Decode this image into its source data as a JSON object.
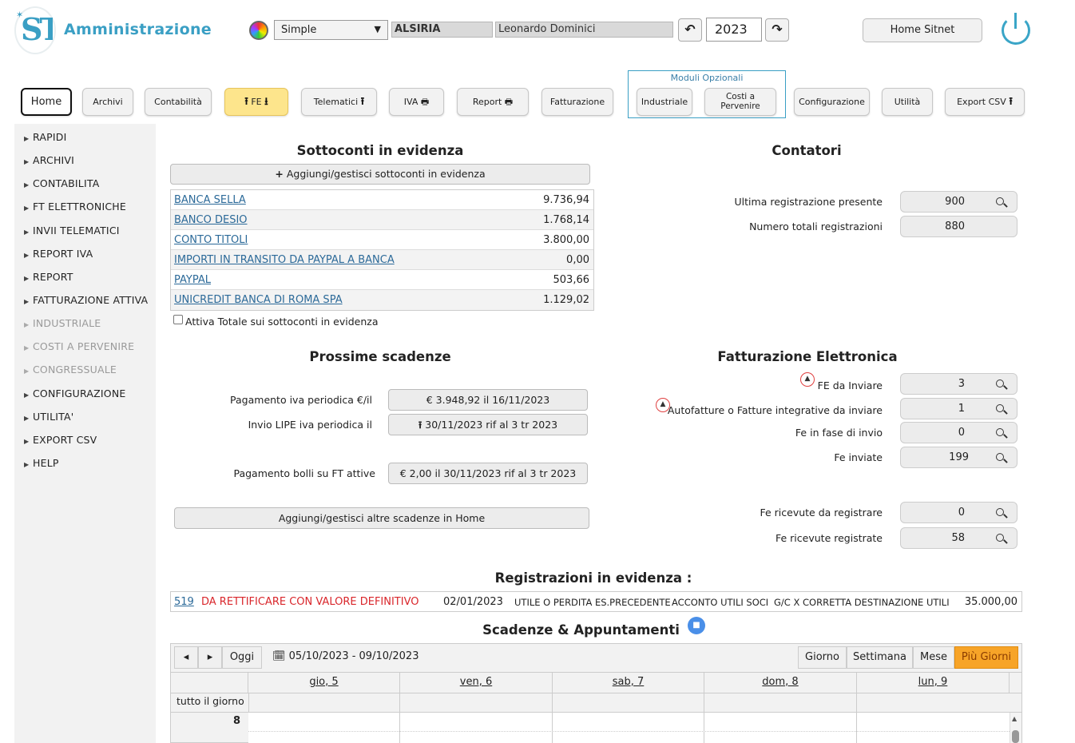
{
  "header": {
    "app_title": "Amministrazione",
    "view_select": "Simple",
    "company": "ALSIRIA",
    "user": "Leonardo Dominici",
    "year": "2023",
    "home_sitnet": "Home Sitnet"
  },
  "toolbar": {
    "home": "Home",
    "archivi": "Archivi",
    "contabilita": "Contabilità",
    "fe": "FE",
    "telematici": "Telematici",
    "iva": "IVA",
    "report": "Report",
    "fatturazione": "Fatturazione",
    "moduli_opzionali": "Moduli Opzionali",
    "industriale": "Industriale",
    "costi_1": "Costi a",
    "costi_2": "Pervenire",
    "configurazione": "Configurazione",
    "utilita": "Utilità",
    "export_csv": "Export CSV"
  },
  "sidebar": {
    "items": [
      {
        "label": "RAPIDI"
      },
      {
        "label": "ARCHIVI"
      },
      {
        "label": "CONTABILITA"
      },
      {
        "label": "FT ELETTRONICHE"
      },
      {
        "label": "INVII TELEMATICI"
      },
      {
        "label": "REPORT IVA"
      },
      {
        "label": "REPORT"
      },
      {
        "label": "FATTURAZIONE ATTIVA"
      },
      {
        "label": "INDUSTRIALE"
      },
      {
        "label": "COSTI A PERVENIRE"
      },
      {
        "label": "CONGRESSUALE"
      },
      {
        "label": "CONFIGURAZIONE"
      },
      {
        "label": "UTILITA'"
      },
      {
        "label": "EXPORT CSV"
      },
      {
        "label": "HELP"
      }
    ]
  },
  "sottoconti": {
    "title": "Sottoconti in evidenza",
    "add_button": "Aggiungi/gestisci sottoconti in evidenza",
    "rows": [
      {
        "name": "BANCA SELLA",
        "value": "9.736,94"
      },
      {
        "name": "BANCO DESIO",
        "value": "1.768,14"
      },
      {
        "name": "CONTO TITOLI",
        "value": "3.800,00"
      },
      {
        "name": "IMPORTI IN TRANSITO DA PAYPAL A BANCA",
        "value": "0,00"
      },
      {
        "name": "PAYPAL",
        "value": "503,66"
      },
      {
        "name": "UNICREDIT BANCA DI ROMA SPA",
        "value": "1.129,02"
      }
    ],
    "checkbox_label": "Attiva Totale sui sottoconti in evidenza"
  },
  "contatori": {
    "title": "Contatori",
    "ultima_label": "Ultima registrazione presente",
    "ultima_value": "900",
    "totali_label": "Numero totali registrazioni",
    "totali_value": "880"
  },
  "scadenze": {
    "title": "Prossime scadenze",
    "iva_label": "Pagamento iva periodica €/il",
    "iva_value": "€ 3.948,92 il 16/11/2023",
    "lipe_label": "Invio LIPE iva periodica il",
    "lipe_value": "30/11/2023 rif al 3 tr 2023",
    "bolli_label": "Pagamento bolli su FT attive",
    "bolli_value": "€ 2,00 il 30/11/2023 rif al 3 tr 2023",
    "add_button": "Aggiungi/gestisci altre scadenze in Home"
  },
  "fe": {
    "title": "Fatturazione Elettronica",
    "rows": [
      {
        "label": "FE da Inviare",
        "value": "3"
      },
      {
        "label": "Autofatture o Fatture integrative da inviare",
        "value": "1"
      },
      {
        "label": "Fe in fase di invio",
        "value": "0"
      },
      {
        "label": "Fe inviate",
        "value": "199"
      },
      {
        "label": "Fe ricevute da registrare",
        "value": "0"
      },
      {
        "label": "Fe ricevute registrate",
        "value": "58"
      }
    ]
  },
  "registrazioni": {
    "title": "Registrazioni in evidenza :",
    "num": "519",
    "note": "DA RETTIFICARE CON VALORE DEFINITIVO",
    "date": "02/01/2023",
    "c1": "UTILE O PERDITA ES.PRECEDENTE",
    "c2": "ACCONTO UTILI SOCI",
    "c3": "G/C X CORRETTA DESTINAZIONE UTILI",
    "amount": "35.000,00"
  },
  "calendar": {
    "title": "Scadenze & Appuntamenti",
    "today": "Oggi",
    "range": "05/10/2023 - 09/10/2023",
    "views": [
      "Giorno",
      "Settimana",
      "Mese",
      "Più Giorni"
    ],
    "days": [
      "gio, 5",
      "ven, 6",
      "sab, 7",
      "dom, 8",
      "lun, 9"
    ],
    "allday": "tutto il giorno",
    "hour": "8"
  },
  "colors": {
    "accent": "#3a9fc4",
    "active_view": "#f7a428",
    "danger": "#d9262b"
  }
}
